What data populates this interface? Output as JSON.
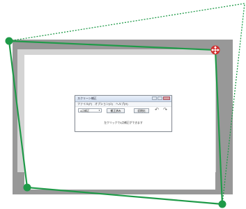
{
  "app_window": {
    "title": "スクリーン補正",
    "menu": [
      "ファイル(F)",
      "オプション(O)",
      "ヘルプ(H)"
    ],
    "toolbar": {
      "select_value": "4点補正",
      "buttons": [
        "補正済み",
        "初期化"
      ],
      "undo_icon": "undo-icon",
      "redo_icon": "redo-icon"
    },
    "message": "左クリックで4点補正ができます"
  },
  "colors": {
    "outline": "#1f9a48",
    "screen_frame": "#989898",
    "screen_inner": "#d4d4d4",
    "dotted": "#1f9a48"
  }
}
